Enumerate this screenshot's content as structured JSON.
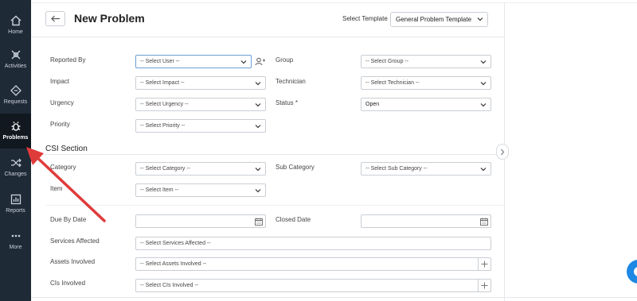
{
  "sidebar": {
    "items": [
      {
        "label": "Home",
        "icon": "home-icon"
      },
      {
        "label": "Activities",
        "icon": "activities-icon"
      },
      {
        "label": "Requests",
        "icon": "requests-icon"
      },
      {
        "label": "Problems",
        "icon": "problems-icon",
        "active": true
      },
      {
        "label": "Changes",
        "icon": "changes-icon"
      },
      {
        "label": "Reports",
        "icon": "reports-icon"
      },
      {
        "label": "More",
        "icon": "more-icon"
      }
    ]
  },
  "header": {
    "title": "New Problem",
    "template_label": "Select Template",
    "template_value": "General Problem Template"
  },
  "form": {
    "reported_by": {
      "label": "Reported By",
      "placeholder": "-- Select User --"
    },
    "group": {
      "label": "Group",
      "placeholder": "-- Select Group --"
    },
    "impact": {
      "label": "Impact",
      "placeholder": "-- Select Impact --"
    },
    "technician": {
      "label": "Technician",
      "placeholder": "-- Select Technician --"
    },
    "urgency": {
      "label": "Urgency",
      "placeholder": "-- Select Urgency --"
    },
    "status": {
      "label": "Status *",
      "value": "Open"
    },
    "priority": {
      "label": "Priority",
      "placeholder": "-- Select Priority --"
    },
    "csi_section": "CSI Section",
    "category": {
      "label": "Category",
      "placeholder": "-- Select Category --"
    },
    "sub_category": {
      "label": "Sub Category",
      "placeholder": "-- Select Sub Category --"
    },
    "item": {
      "label": "Item",
      "placeholder": "-- Select Item --"
    },
    "due_by_date": {
      "label": "Due By Date"
    },
    "closed_date": {
      "label": "Closed Date"
    },
    "services_affected": {
      "label": "Services Affected",
      "placeholder": "-- Select Services Affected --"
    },
    "assets_involved": {
      "label": "Assets Involved",
      "placeholder": "-- Select Assets Involved --"
    },
    "cis_involved": {
      "label": "CIs Involved",
      "placeholder": "-- Select CIs Involved --"
    }
  },
  "colors": {
    "sidebar_bg": "#1f2a37",
    "sidebar_active_bg": "#111820",
    "annotation_arrow": "#e03b3b",
    "fab": "#1e88e5",
    "focus_border": "#6ba0d6"
  }
}
